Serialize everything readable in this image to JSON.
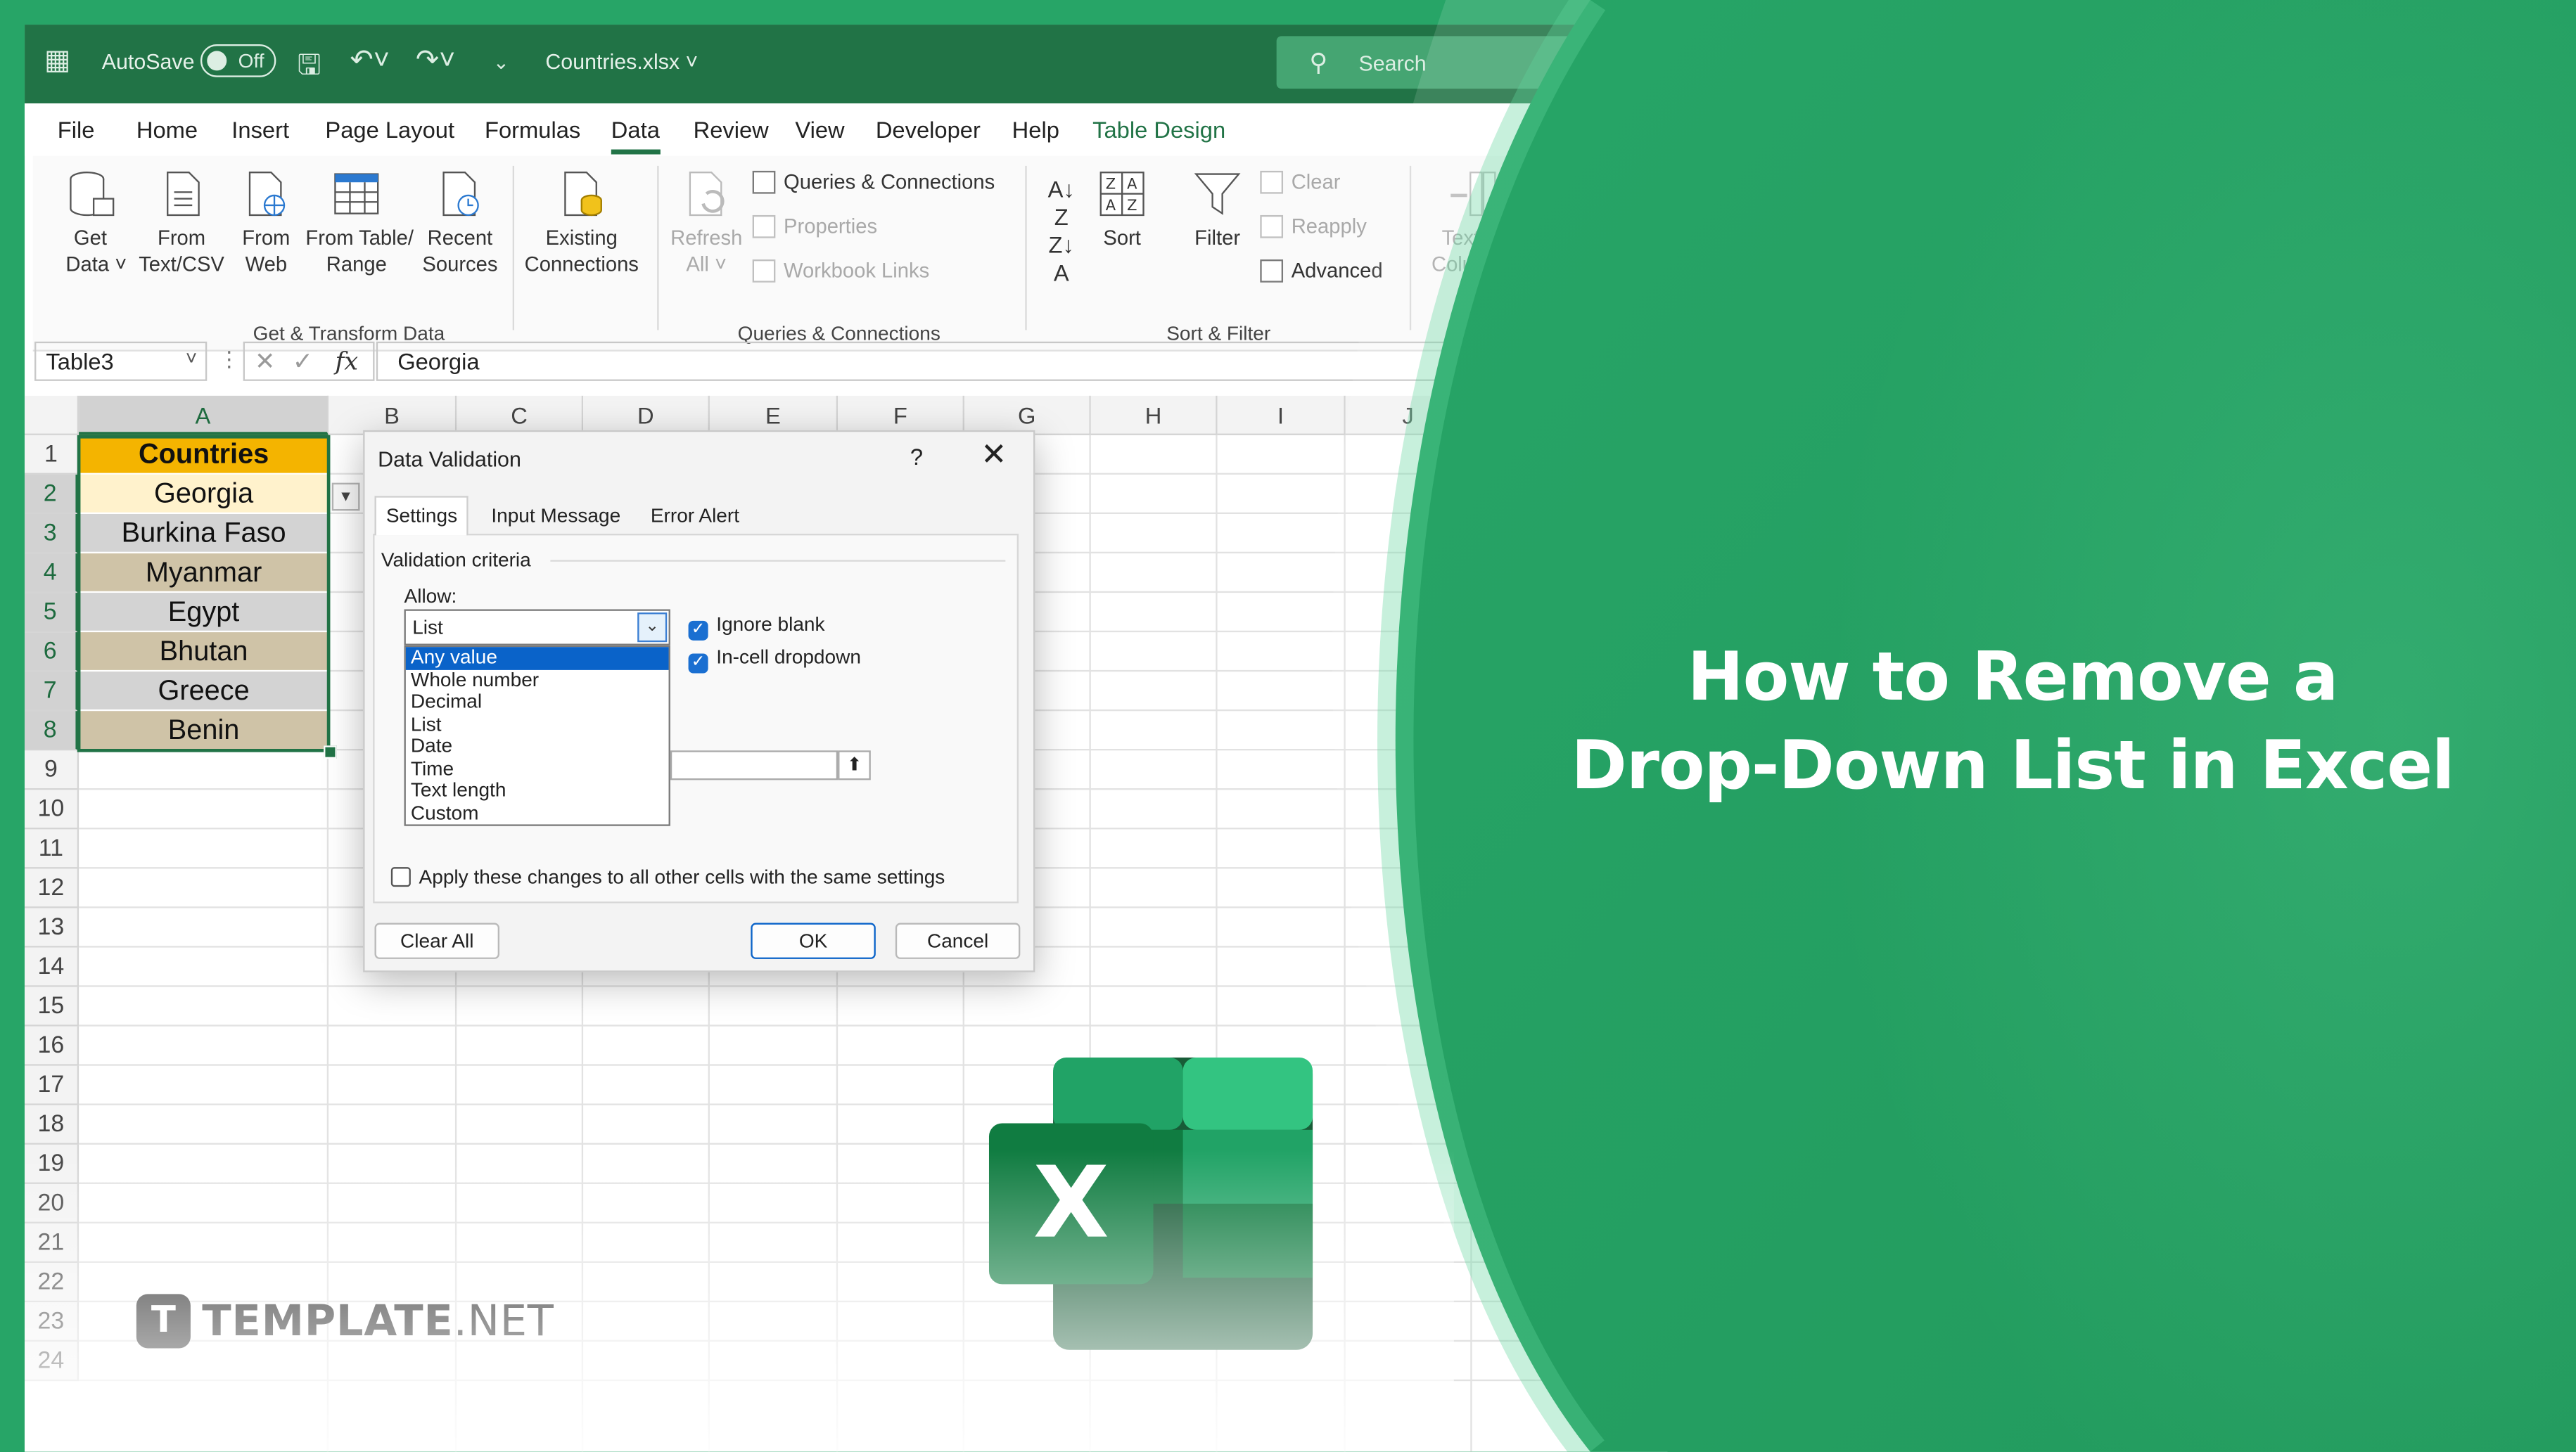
{
  "titlebar": {
    "autosave_label": "AutoSave",
    "autosave_state": "Off",
    "filename": "Countries.xlsx",
    "search_placeholder": "Search"
  },
  "menu": [
    "File",
    "Home",
    "Insert",
    "Page Layout",
    "Formulas",
    "Data",
    "Review",
    "View",
    "Developer",
    "Help",
    "Table Design"
  ],
  "menu_active": "Data",
  "ribbon": {
    "get_transform": {
      "buttons": [
        {
          "l1": "Get",
          "l2": "Data ˅"
        },
        {
          "l1": "From",
          "l2": "Text/CSV"
        },
        {
          "l1": "From",
          "l2": "Web"
        },
        {
          "l1": "From Table/",
          "l2": "Range"
        },
        {
          "l1": "Recent",
          "l2": "Sources"
        },
        {
          "l1": "Existing",
          "l2": "Connections"
        }
      ],
      "label": "Get & Transform Data"
    },
    "queries": {
      "refresh": {
        "l1": "Refresh",
        "l2": "All ˅"
      },
      "items": [
        "Queries & Connections",
        "Properties",
        "Workbook Links"
      ],
      "label": "Queries & Connections"
    },
    "sort_filter": {
      "sort": "Sort",
      "filter": "Filter",
      "items": [
        "Clear",
        "Reapply",
        "Advanced"
      ],
      "label": "Sort & Filter"
    },
    "text_to_columns": {
      "l1": "Text to",
      "l2": "Columns"
    }
  },
  "formula_bar": {
    "name_box": "Table3",
    "formula": "Georgia"
  },
  "columns": [
    "A",
    "B",
    "C",
    "D",
    "E",
    "F",
    "G",
    "H",
    "I",
    "J"
  ],
  "rows": [
    "1",
    "2",
    "3",
    "4",
    "5",
    "6",
    "7",
    "8",
    "9",
    "10",
    "11",
    "12",
    "13",
    "14",
    "15",
    "16",
    "17",
    "18",
    "19",
    "20",
    "21",
    "22",
    "23",
    "24"
  ],
  "table": {
    "header": "Countries",
    "values": [
      "Georgia",
      "Burkina Faso",
      "Myanmar",
      "Egypt",
      "Bhutan",
      "Greece",
      "Benin"
    ]
  },
  "dialog": {
    "title": "Data Validation",
    "help": "?",
    "close": "✕",
    "tabs": [
      "Settings",
      "Input Message",
      "Error Alert"
    ],
    "criteria_label": "Validation criteria",
    "allow_label": "Allow:",
    "allow_value": "List",
    "options": [
      "Any value",
      "Whole number",
      "Decimal",
      "List",
      "Date",
      "Time",
      "Text length",
      "Custom"
    ],
    "highlighted_option": "Any value",
    "ignore_blank": "Ignore blank",
    "incell_dropdown": "In-cell dropdown",
    "apply_all": "Apply these changes to all other cells with the same settings",
    "clear_all": "Clear All",
    "ok": "OK",
    "cancel": "Cancel"
  },
  "headline": {
    "line1": "How to Remove a",
    "line2": "Drop-Down List in Excel"
  },
  "logo": {
    "mark": "T",
    "word_bold": "TEMPLATE",
    "word_light": ".NET"
  },
  "excel_logo_letter": "X",
  "colors": {
    "excel_green": "#217346",
    "banner_green": "#27a567",
    "table_header": "#f4b400"
  }
}
